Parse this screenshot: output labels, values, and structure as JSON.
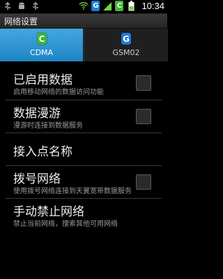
{
  "status_bar": {
    "icons": [
      "usb-icon",
      "android-icon",
      "usb-icon",
      "wifi-icon",
      "sim-g-icon",
      "sim-c-icon",
      "battery-icon"
    ],
    "sim_g_letter": "G",
    "sim_c_letter": "C",
    "time": "10:34",
    "colors": {
      "sim_g": "#1e7fd6",
      "sim_c": "#47b43a"
    }
  },
  "title_bar": {
    "title": "网络设置"
  },
  "tabs": [
    {
      "letter": "C",
      "label": "CDMA",
      "selected": true,
      "color": "#3fb23a"
    },
    {
      "letter": "G",
      "label": "GSM02",
      "selected": false,
      "color": "#1f79d3"
    }
  ],
  "settings": [
    {
      "title": "已启用数据",
      "subtitle": "启用移动网络的数据访问功能",
      "checkbox": true,
      "checked": false
    },
    {
      "title": "数据漫游",
      "subtitle": "漫游时连接到数据服务",
      "checkbox": true,
      "checked": false
    },
    {
      "title": "接入点名称",
      "subtitle": "",
      "checkbox": false
    },
    {
      "title": "拨号网络",
      "subtitle": "使用拨号网络连接到天翼宽带数据服务",
      "checkbox": true,
      "checked": false
    },
    {
      "title": "手动禁止网络",
      "subtitle": "禁止当前网络，搜索其他可用网络",
      "checkbox": false
    }
  ],
  "accent": "#2c8fd0"
}
